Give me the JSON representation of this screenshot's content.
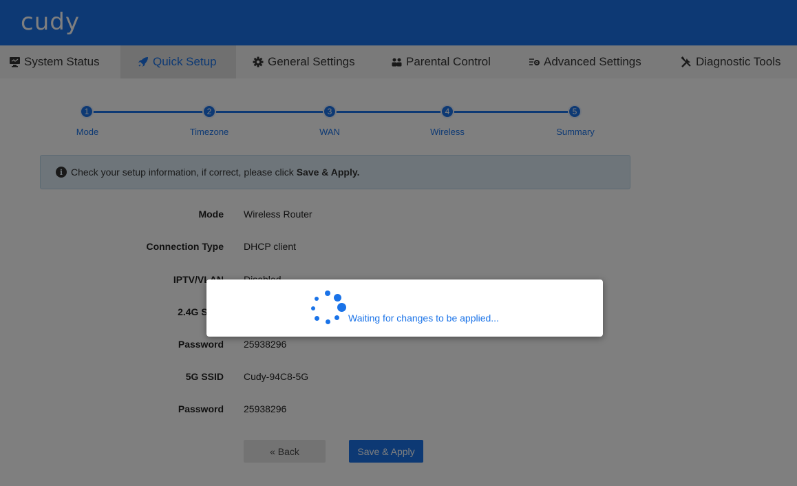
{
  "brand": {
    "logo_text": "cudy"
  },
  "nav": {
    "items": [
      {
        "label": "System Status",
        "icon": "monitor-icon"
      },
      {
        "label": "Quick Setup",
        "icon": "rocket-icon",
        "active": true
      },
      {
        "label": "General Settings",
        "icon": "gear-icon"
      },
      {
        "label": "Parental Control",
        "icon": "users-icon"
      },
      {
        "label": "Advanced Settings",
        "icon": "sliders-icon"
      },
      {
        "label": "Diagnostic Tools",
        "icon": "tools-icon"
      }
    ]
  },
  "stepper": {
    "steps": [
      {
        "number": "1",
        "label": "Mode"
      },
      {
        "number": "2",
        "label": "Timezone"
      },
      {
        "number": "3",
        "label": "WAN"
      },
      {
        "number": "4",
        "label": "Wireless"
      },
      {
        "number": "5",
        "label": "Summary"
      }
    ]
  },
  "info": {
    "text": "Check your setup information, if correct, please click",
    "emphasis": "Save & Apply."
  },
  "summary": {
    "rows": [
      {
        "label": "Mode",
        "value": "Wireless Router"
      },
      {
        "label": "Connection Type",
        "value": "DHCP client"
      },
      {
        "label": "IPTV/VLAN",
        "value": "Disabled"
      },
      {
        "label": "2.4G SSID",
        "value": ""
      },
      {
        "label": "Password",
        "value": "25938296"
      },
      {
        "label": "5G SSID",
        "value": "Cudy-94C8-5G"
      },
      {
        "label": "Password",
        "value": "25938296"
      }
    ]
  },
  "buttons": {
    "back": "« Back",
    "save": "Save & Apply"
  },
  "modal": {
    "text": "Waiting for changes to be applied..."
  },
  "colors": {
    "brand": "#1a73e8",
    "overlay": "rgba(0,0,0,0.5)"
  }
}
